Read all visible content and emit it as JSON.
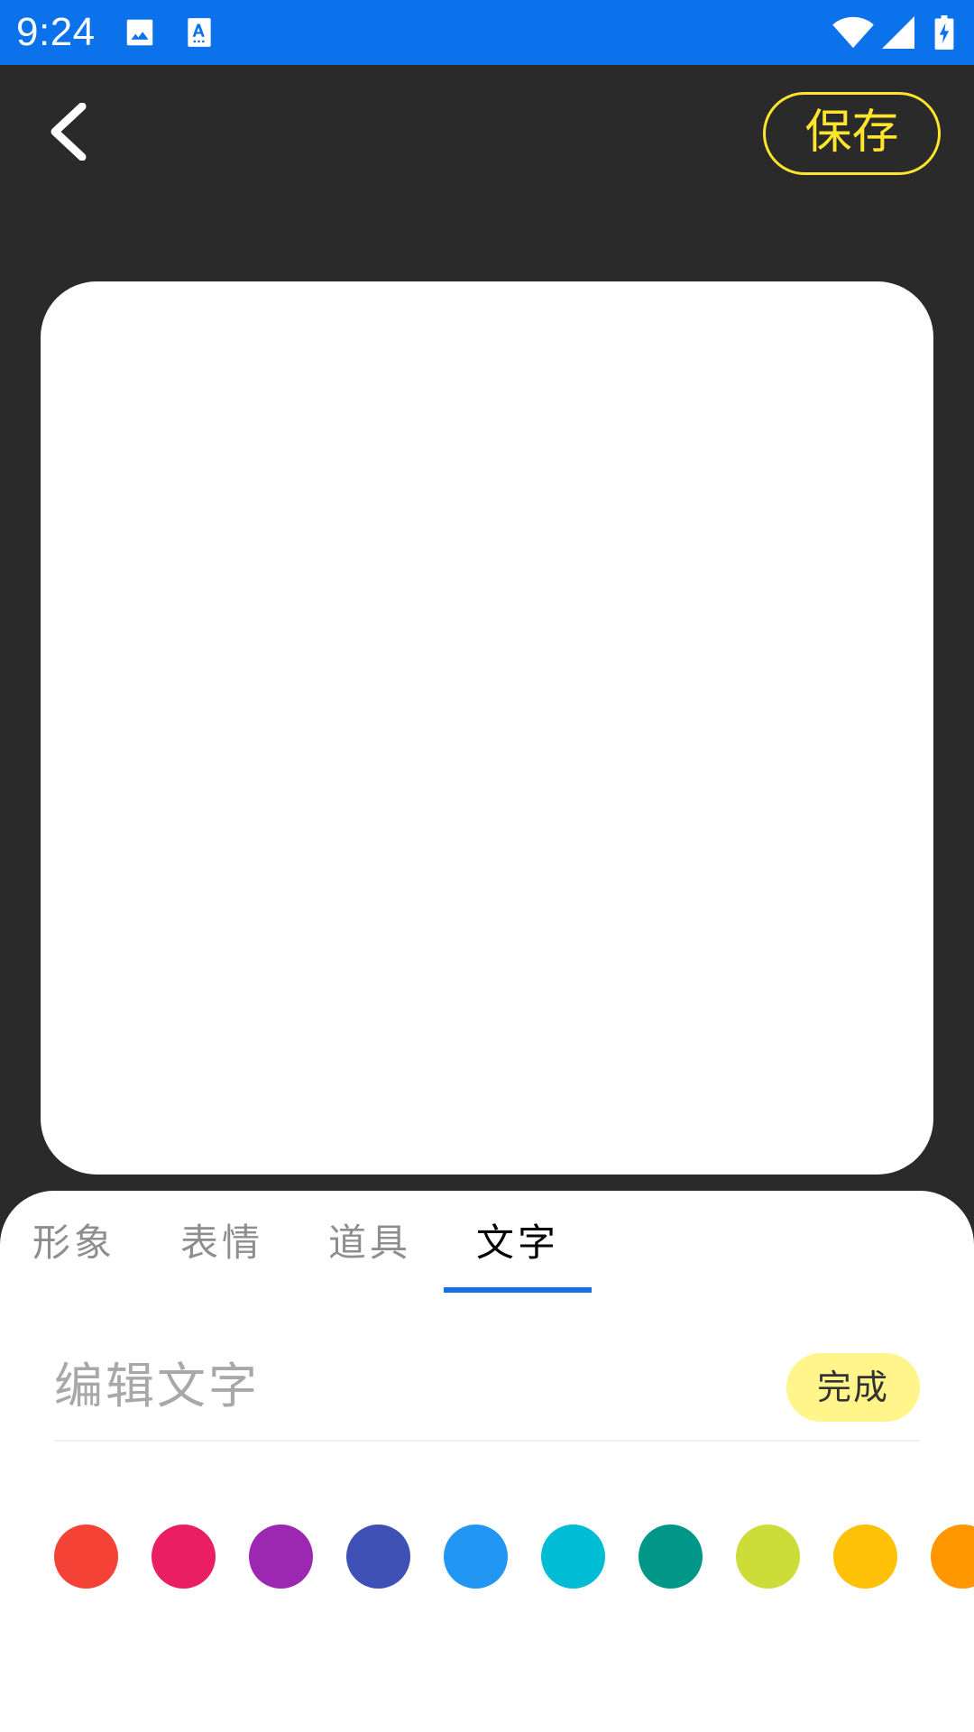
{
  "status_bar": {
    "time": "9:24",
    "background": "#0b72ec",
    "left_icons": [
      "image-icon",
      "text-recognition-icon"
    ],
    "right_icons": [
      "wifi-icon",
      "cell-signal-icon",
      "battery-charging-icon"
    ]
  },
  "top_bar": {
    "back_icon": "chevron-left-icon",
    "save_label": "保存",
    "accent_color": "#ffe52c"
  },
  "canvas": {
    "background": "#ffffff"
  },
  "editor": {
    "tabs": [
      {
        "label": "形象",
        "active": false
      },
      {
        "label": "表情",
        "active": false
      },
      {
        "label": "道具",
        "active": false
      },
      {
        "label": "文字",
        "active": true
      }
    ],
    "indicator_color": "#1670e8",
    "text_input": {
      "value": "",
      "placeholder": "编辑文字"
    },
    "done_label": "完成",
    "done_color": "#fff58a",
    "colors": [
      "#f44336",
      "#e91e63",
      "#9c27b0",
      "#3f51b5",
      "#2196f3",
      "#00bcd4",
      "#009688",
      "#cddc39",
      "#ffc107",
      "#ff9800"
    ]
  }
}
